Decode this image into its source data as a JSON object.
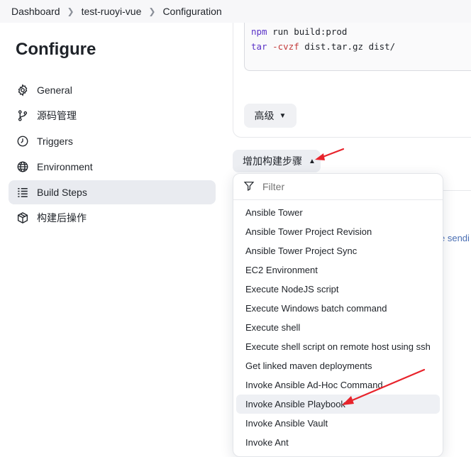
{
  "breadcrumb": {
    "items": [
      "Dashboard",
      "test-ruoyi-vue",
      "Configuration"
    ]
  },
  "sidebar": {
    "title": "Configure",
    "items": [
      {
        "label": "General",
        "icon": "gear-icon"
      },
      {
        "label": "源码管理",
        "icon": "branch-icon"
      },
      {
        "label": "Triggers",
        "icon": "clock-icon"
      },
      {
        "label": "Environment",
        "icon": "globe-icon"
      },
      {
        "label": "Build Steps",
        "icon": "list-icon",
        "active": true
      },
      {
        "label": "构建后操作",
        "icon": "cube-icon"
      }
    ]
  },
  "code": {
    "line1": {
      "cmd": "npm",
      "rest": " run build:prod"
    },
    "line2": {
      "cmd": "tar",
      "opt": " -cvzf",
      "rest": " dist.tar.gz dist/"
    }
  },
  "advanced_label": "高级",
  "add_step_label": "增加构建步骤",
  "partial_text": "e sendi",
  "dropdown": {
    "filter_placeholder": "Filter",
    "options": [
      "Ansible Tower",
      "Ansible Tower Project Revision",
      "Ansible Tower Project Sync",
      "EC2 Environment",
      "Execute NodeJS script",
      "Execute Windows batch command",
      "Execute shell",
      "Execute shell script on remote host using ssh",
      "Get linked maven deployments",
      "Invoke Ansible Ad-Hoc Command",
      "Invoke Ansible Playbook",
      "Invoke Ansible Vault",
      "Invoke Ant"
    ],
    "highlighted": "Invoke Ansible Playbook"
  },
  "colors": {
    "annotation_arrow": "#e8232b",
    "highlight": "#eef0f4",
    "active_nav": "#e9ebf0"
  }
}
